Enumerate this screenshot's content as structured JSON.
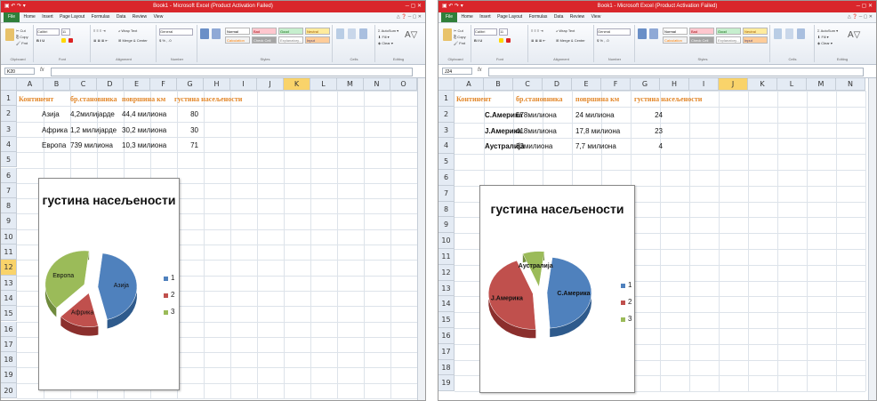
{
  "left": {
    "window_title": "Book1 - Microsoft Excel (Product Activation Failed)",
    "name_box": "K20",
    "columns": [
      "A",
      "B",
      "C",
      "D",
      "E",
      "F",
      "G",
      "H",
      "I",
      "J",
      "K",
      "L",
      "M",
      "N",
      "O"
    ],
    "selected_col": "K",
    "rows": [
      "1",
      "2",
      "3",
      "4",
      "5",
      "6",
      "7",
      "8",
      "9",
      "10",
      "11",
      "12",
      "13",
      "14",
      "15",
      "16",
      "17",
      "18",
      "19",
      "20"
    ],
    "selected_row": "12",
    "headers": {
      "c1": "Континент",
      "c2": "бр.становника",
      "c3": "површина км",
      "c4": "густина насељености"
    },
    "data": [
      {
        "cont": "Азија",
        "pop": "4,2милијарде",
        "area": "44,4 милиона",
        "dens": "80"
      },
      {
        "cont": "Африка",
        "pop": "1,2 милијарде",
        "area": "30,2 милиона",
        "dens": "30"
      },
      {
        "cont": "Европа",
        "pop": "739 милиона",
        "area": "10,3 милиона",
        "dens": "71"
      }
    ],
    "chart_title": "густина насељености",
    "pie_labels": [
      "Азија",
      "Африка",
      "Европа"
    ],
    "legend": [
      "1",
      "2",
      "3"
    ]
  },
  "right": {
    "window_title": "Book1 - Microsoft Excel (Product Activation Failed)",
    "name_box": "J24",
    "columns": [
      "A",
      "B",
      "C",
      "D",
      "E",
      "F",
      "G",
      "H",
      "I",
      "J",
      "K",
      "L",
      "M",
      "N"
    ],
    "selected_col": "J",
    "rows": [
      "1",
      "2",
      "3",
      "4",
      "5",
      "6",
      "7",
      "8",
      "9",
      "10",
      "11",
      "12",
      "13",
      "14",
      "15",
      "16",
      "17",
      "18",
      "19"
    ],
    "headers": {
      "c1": "Континент",
      "c2": "бр.становника",
      "c3": "површина км",
      "c4": "густина насељености"
    },
    "data": [
      {
        "cont": "С.Америка",
        "pop": "578милиона",
        "area": "24 милиона",
        "dens": "24"
      },
      {
        "cont": "Ј.Америка",
        "pop": "418милиона",
        "area": "17,8 милиона",
        "dens": "23"
      },
      {
        "cont": "Аустралија",
        "pop": "32милиона",
        "area": "7,7 милиона",
        "dens": "4"
      }
    ],
    "chart_title": "густина насељености",
    "pie_labels": [
      "С.Америка",
      "Ј.Америка",
      "Аустралија"
    ],
    "legend": [
      "1",
      "2",
      "3"
    ]
  },
  "menu": [
    "Home",
    "Insert",
    "Page Layout",
    "Formulas",
    "Data",
    "Review",
    "View"
  ],
  "file_label": "File",
  "styles": [
    "Normal",
    "Bad",
    "Good",
    "Neutral",
    "Calculation",
    "Check Cell",
    "Explanatory...",
    "Input"
  ],
  "ribbon_groups": [
    "Clipboard",
    "Font",
    "Alignment",
    "Number",
    "Styles",
    "Cells",
    "Editing"
  ],
  "ribbon_font": "Calibri",
  "ribbon_size": "11",
  "ribbon_numfmt": "General",
  "colors": {
    "series1": "#4f81bd",
    "series2": "#c0504d",
    "series3": "#9bbb59",
    "header_orange": "#e2872a",
    "titlebar": "#d9262b"
  }
}
